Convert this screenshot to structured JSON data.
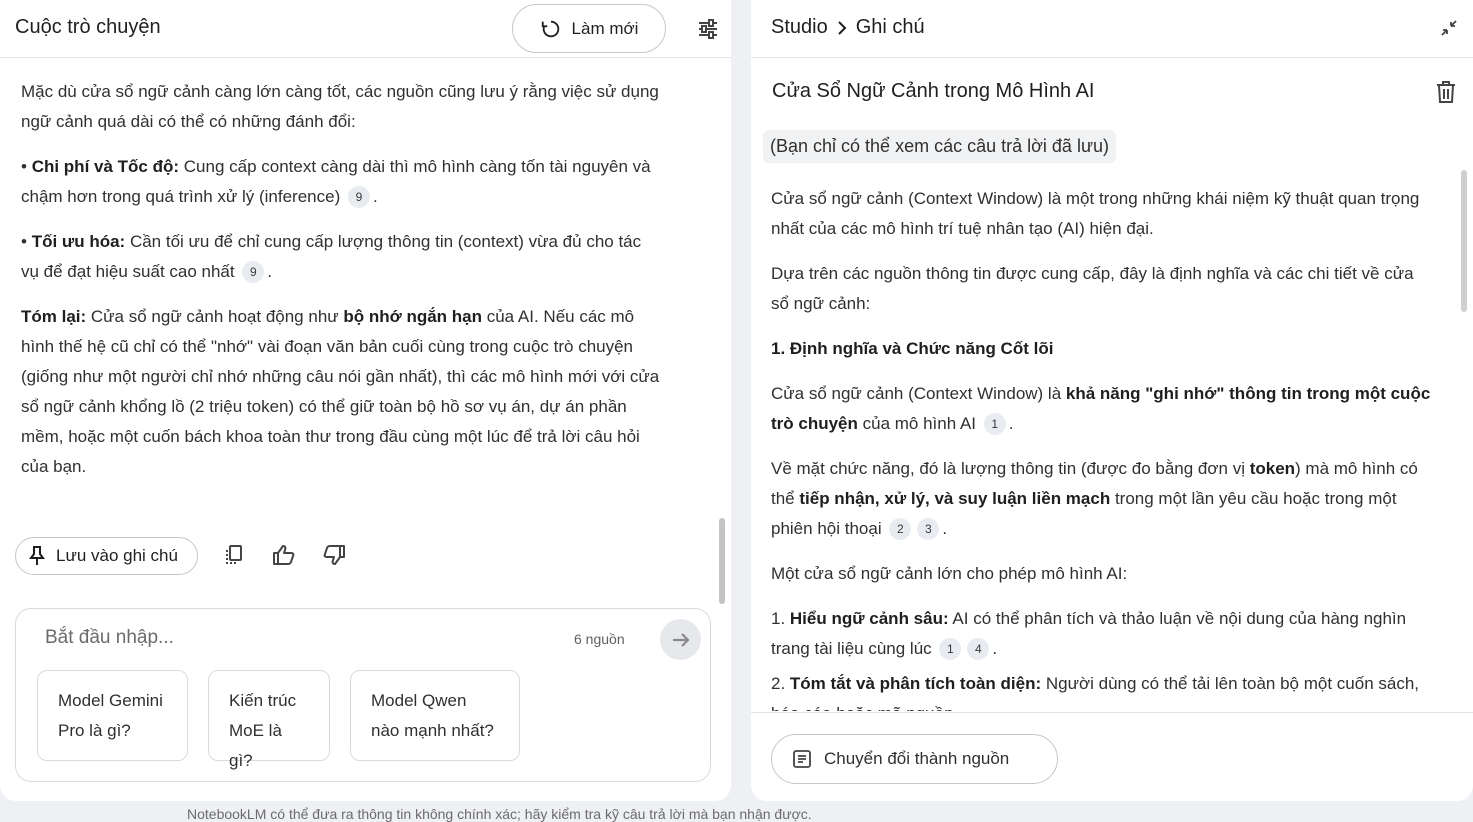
{
  "chat_panel": {
    "title": "Cuộc trò chuyện",
    "refresh_label": "Làm mới",
    "tune_icon": "tune-icon",
    "paragraphs": {
      "intro": "Mặc dù cửa sổ ngữ cảnh càng lớn càng tốt, các nguồn cũng lưu ý rằng việc sử dụng ngữ cảnh quá dài có thể có những đánh đổi:",
      "cost_bold": "Chi phí và Tốc độ:",
      "cost_text": " Cung cấp context càng dài thì mô hình càng tốn tài nguyên và chậm hơn trong quá trình xử lý (inference) ",
      "cost_cite": "9",
      "opt_bold": "Tối ưu hóa:",
      "opt_text": " Cần tối ưu để chỉ cung cấp lượng thông tin (context) vừa đủ cho tác vụ để đạt hiệu suất cao nhất ",
      "opt_cite": "9",
      "summary_bold": "Tóm lại:",
      "summary_text1": " Cửa sổ ngữ cảnh hoạt động như ",
      "summary_bold2": "bộ nhớ ngắn hạn",
      "summary_text2": " của AI. Nếu các mô hình thế hệ cũ chỉ có thể \"nhớ\" vài đoạn văn bản cuối cùng trong cuộc trò chuyện (giống như một người chỉ nhớ những câu nói gần nhất), thì các mô hình mới với cửa sổ ngữ cảnh khổng lồ (2 triệu token) có thể giữ toàn bộ hồ sơ vụ án, dự án phần mềm, hoặc một cuốn bách khoa toàn thư trong đầu cùng một lúc để trả lời câu hỏi của bạn."
    },
    "save_note_label": "Lưu vào ghi chú",
    "input_placeholder": "Bắt đầu nhập...",
    "source_count": "6 nguồn",
    "suggestions": [
      "Model Gemini Pro là gì?",
      "Kiến trúc MoE là gì?",
      "Model Qwen nào mạnh nhất?"
    ]
  },
  "footer_note": "NotebookLM có thể đưa ra thông tin không chính xác; hãy kiểm tra kỹ câu trả lời mà bạn nhận được.",
  "studio_panel": {
    "breadcrumb": [
      "Studio",
      "Ghi chú"
    ],
    "note_title": "Cửa Sổ Ngữ Cảnh trong Mô Hình AI",
    "saved_badge": "(Bạn chỉ có thể xem các câu trả lời đã lưu)",
    "body": {
      "p1": "Cửa sổ ngữ cảnh (Context Window) là một trong những khái niệm kỹ thuật quan trọng nhất của các mô hình trí tuệ nhân tạo (AI) hiện đại.",
      "p2": "Dựa trên các nguồn thông tin được cung cấp, đây là định nghĩa và các chi tiết về cửa sổ ngữ cảnh:",
      "h1": "1. Định nghĩa và Chức năng Cốt lõi",
      "p3_a": "Cửa sổ ngữ cảnh (Context Window) là ",
      "p3_bold": "khả năng \"ghi nhớ\" thông tin trong một cuộc trò chuyện",
      "p3_b": " của mô hình AI ",
      "p3_cite": "1",
      "p4_a": "Về mặt chức năng, đó là lượng thông tin (được đo bằng đơn vị ",
      "p4_bold1": "token",
      "p4_b": ") mà mô hình có thể ",
      "p4_bold2": "tiếp nhận, xử lý, và suy luận liền mạch",
      "p4_c": " trong một lần yêu cầu hoặc trong một phiên hội thoại ",
      "p4_cite1": "2",
      "p4_cite2": "3",
      "p5": "Một cửa sổ ngữ cảnh lớn cho phép mô hình AI:",
      "li1_num": "1. ",
      "li1_bold": "Hiểu ngữ cảnh sâu:",
      "li1_text": " AI có thể phân tích và thảo luận về nội dung của hàng nghìn trang tài liệu cùng lúc ",
      "li1_cite1": "1",
      "li1_cite2": "4",
      "li2_num": "2. ",
      "li2_bold": "Tóm tắt và phân tích toàn diện:",
      "li2_text": " Người dùng có thể tải lên toàn bộ một cuốn sách, báo cáo hoặc mã nguồn"
    },
    "convert_label": "Chuyển đổi thành nguồn"
  }
}
